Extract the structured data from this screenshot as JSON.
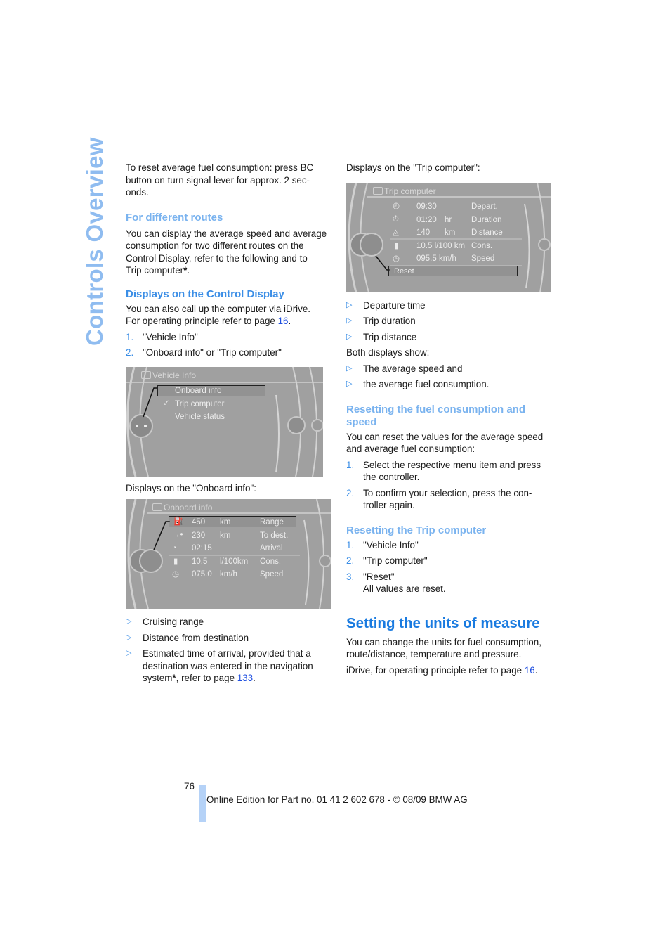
{
  "side_title": "Controls Overview",
  "left": {
    "intro": "To reset average fuel consumption: press BC button on turn signal lever for approx. 2 seconds.",
    "intro_lines": [
      "To reset average fuel consumption: press BC",
      "button on turn signal lever for approx. 2 sec-",
      "onds."
    ],
    "routes_heading": "For different routes",
    "routes_lines": [
      "You can display the average speed and average",
      "consumption for two different routes on the",
      "Control Display, refer to the following and to",
      "Trip computer"
    ],
    "routes_star": "*",
    "routes_end": ".",
    "display_heading": "Displays on the Control Display",
    "display_line1": "You can also call up the computer via iDrive.",
    "display_line2": "For operating principle refer to page ",
    "display_page": "16",
    "display_end": ".",
    "steps": [
      {
        "num": "1.",
        "text": "\"Vehicle Info\""
      },
      {
        "num": "2.",
        "text": "\"Onboard info\" or \"Trip computer\""
      }
    ],
    "vehicle_info_screen": {
      "title": "Vehicle Info",
      "items": [
        {
          "label": "Onboard info",
          "highlighted": true,
          "checked": false
        },
        {
          "label": "Trip computer",
          "highlighted": false,
          "checked": true
        },
        {
          "label": "Vehicle status",
          "highlighted": false,
          "checked": false
        }
      ],
      "check_glyph": "✓"
    },
    "onboard_caption": "Displays on the \"Onboard info\":",
    "onboard_screen": {
      "title": "Onboard info",
      "rows": [
        {
          "icon": "fuel-pump-icon",
          "value": "450",
          "unit": "km",
          "label": "Range"
        },
        {
          "icon": "arrow-destination-icon",
          "value": "230",
          "unit": "km",
          "label": "To dest."
        },
        {
          "icon": "clock-icon",
          "value": "02:15",
          "unit": "",
          "label": "Arrival"
        },
        {
          "icon": "fuel-consumption-icon",
          "value": "10.5",
          "unit": "l/100km",
          "label": "Cons."
        },
        {
          "icon": "speedometer-icon",
          "value": "075.0",
          "unit": "km/h",
          "label": "Speed"
        }
      ]
    },
    "onboard_bullets": [
      {
        "text": "Cruising range"
      },
      {
        "text": "Distance from destination"
      },
      {
        "lines": [
          "Estimated time of arrival, provided that a",
          "destination was entered in the navigation",
          "system"
        ],
        "star": "*",
        "mid": ", refer to page ",
        "page": "133",
        "end": "."
      }
    ]
  },
  "right": {
    "trip_caption": "Displays on the \"Trip computer\":",
    "trip_screen": {
      "title": "Trip computer",
      "rows": [
        {
          "icon": "departure-clock-icon",
          "value": "09:30",
          "unit": "",
          "label": "Depart."
        },
        {
          "icon": "stopwatch-icon",
          "value": "01:20",
          "unit": "hr",
          "label": "Duration"
        },
        {
          "icon": "distance-icon",
          "value": "140",
          "unit": "km",
          "label": "Distance"
        },
        {
          "icon": "fuel-consumption-icon",
          "value": "10.5 l/100 km",
          "unit": "",
          "label": "Cons."
        },
        {
          "icon": "speedometer-icon",
          "value": "095.5 km/h",
          "unit": "",
          "label": "Speed"
        }
      ],
      "reset_label": "Reset"
    },
    "trip_bullets": [
      "Departure time",
      "Trip duration",
      "Trip distance"
    ],
    "both_show": "Both displays show:",
    "both_bullets": [
      "The average speed and",
      "the average fuel consumption."
    ],
    "reset_fuel_heading": [
      "Resetting the fuel consumption and",
      "speed"
    ],
    "reset_fuel_intro": [
      "You can reset the values for the average speed",
      "and average fuel consumption:"
    ],
    "reset_fuel_steps": [
      {
        "num": "1.",
        "lines": [
          "Select the respective menu item and press",
          "the controller."
        ]
      },
      {
        "num": "2.",
        "lines": [
          "To confirm your selection, press the con-",
          "troller again."
        ]
      }
    ],
    "reset_trip_heading": "Resetting the Trip computer",
    "reset_trip_steps": [
      {
        "num": "1.",
        "lines": [
          "\"Vehicle Info\""
        ]
      },
      {
        "num": "2.",
        "lines": [
          "\"Trip computer\""
        ]
      },
      {
        "num": "3.",
        "lines": [
          "\"Reset\"",
          "All values are reset."
        ]
      }
    ],
    "units_heading": "Setting the units of measure",
    "units_lines": [
      "You can change the units for fuel consumption,",
      "route/distance, temperature and pressure."
    ],
    "units_idrive": "iDrive, for operating principle refer to page ",
    "units_page": "16",
    "units_end": "."
  },
  "footer": {
    "page_number": "76",
    "text": "Online Edition for Part no. 01 41 2 602 678 - © 08/09 BMW AG"
  },
  "bullet_glyph": "▷"
}
